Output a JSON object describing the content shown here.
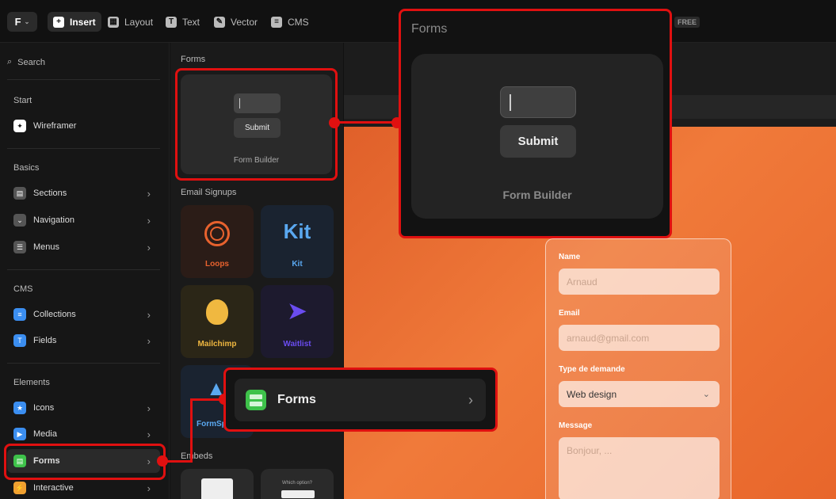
{
  "toolbar": {
    "logo": "F",
    "tools": [
      {
        "label": "Insert",
        "icon": "plus-icon",
        "active": true
      },
      {
        "label": "Layout",
        "icon": "layout-icon"
      },
      {
        "label": "Text",
        "icon": "text-icon"
      },
      {
        "label": "Vector",
        "icon": "vector-pen-icon"
      },
      {
        "label": "CMS",
        "icon": "database-icon"
      }
    ],
    "badge": "FREE"
  },
  "sidebar": {
    "search": "Search",
    "sections": {
      "start": "Start",
      "basics": "Basics",
      "cms": "CMS",
      "elements": "Elements"
    },
    "items": {
      "wireframer": "Wireframer",
      "sections": "Sections",
      "navigation": "Navigation",
      "menus": "Menus",
      "collections": "Collections",
      "fields": "Fields",
      "icons": "Icons",
      "media": "Media",
      "forms": "Forms",
      "interactive": "Interactive"
    }
  },
  "panel": {
    "forms_title": "Forms",
    "form_builder_card": {
      "submit": "Submit",
      "label": "Form Builder"
    },
    "email_signups_title": "Email Signups",
    "signups": [
      {
        "label": "Loops",
        "color": "#e8622e"
      },
      {
        "label": "Kit",
        "color": "#5aa8f0"
      },
      {
        "label": "Mailchimp",
        "color": "#f0b840"
      },
      {
        "label": "Waitlist",
        "color": "#6a4cf0"
      },
      {
        "label": "FormSp",
        "color": "#5aa8f0"
      }
    ],
    "kit_logo": "Kit",
    "embeds_title": "Embeds",
    "embed_card_text": "Which option?"
  },
  "canvas_form": {
    "name_label": "Name",
    "name_placeholder": "Arnaud",
    "email_label": "Email",
    "email_placeholder": "arnaud@gmail.com",
    "type_label": "Type de demande",
    "type_value": "Web design",
    "message_label": "Message",
    "message_placeholder": "Bonjour, ..."
  },
  "callout_big": {
    "title": "Forms",
    "submit": "Submit",
    "label": "Form Builder"
  },
  "callout_small": {
    "label": "Forms"
  },
  "colors": {
    "highlight": "#e01010",
    "accent_orange": "#e8662b"
  }
}
